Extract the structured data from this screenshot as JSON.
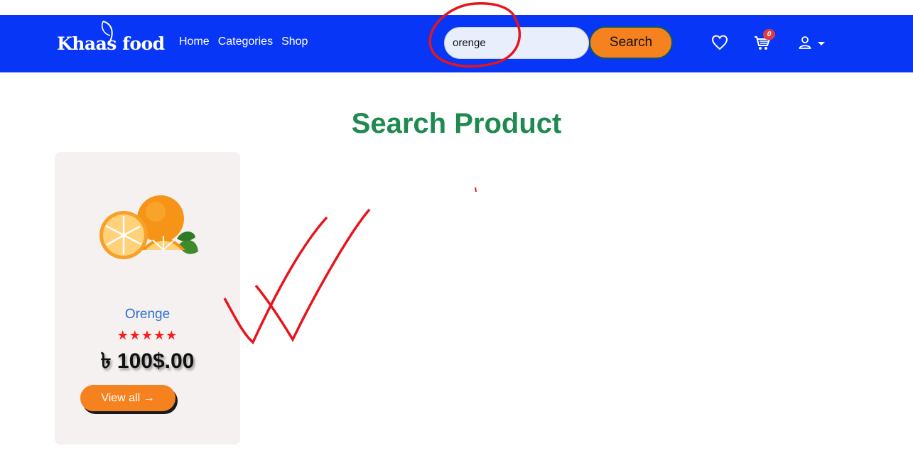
{
  "brand": {
    "name": "Khaas food"
  },
  "nav": {
    "links": [
      "Home",
      "Categories",
      "Shop"
    ]
  },
  "search": {
    "value": "orenge",
    "button_label": "Search"
  },
  "header_icons": {
    "wishlist": "heart-icon",
    "cart": "cart-icon",
    "cart_count": "0",
    "account": "user-icon"
  },
  "page": {
    "title": "Search Product"
  },
  "products": [
    {
      "name": "Orenge",
      "rating": 5,
      "stars": "★★★★★",
      "price": "৳ 100$.00",
      "button_label": "View all →",
      "image": "orange-fruit"
    }
  ],
  "colors": {
    "navbar": "#0836f7",
    "accent": "#f5821f",
    "title": "#1e8a50",
    "product_name": "#2f6fd6",
    "stars": "#ff1a1a",
    "annotation": "#e8141c"
  }
}
